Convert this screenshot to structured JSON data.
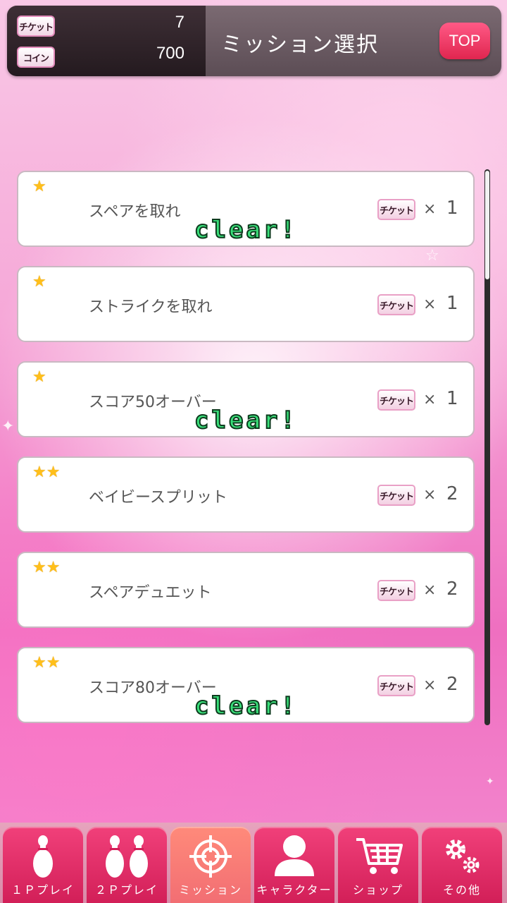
{
  "header": {
    "ticket_label": "チケット",
    "ticket_count": "7",
    "coin_label": "コイン",
    "coin_count": "700",
    "title": "ミッション選択",
    "top_button": "TOP"
  },
  "missions": [
    {
      "stars": "★",
      "name": "スペアを取れ",
      "reward_icon": "チケット",
      "reward_x": "×",
      "reward_qty": "1",
      "status": "clear!"
    },
    {
      "stars": "★",
      "name": "ストライクを取れ",
      "reward_icon": "チケット",
      "reward_x": "×",
      "reward_qty": "1",
      "status": ""
    },
    {
      "stars": "★",
      "name": "スコア50オーバー",
      "reward_icon": "チケット",
      "reward_x": "×",
      "reward_qty": "1",
      "status": "clear!"
    },
    {
      "stars": "★★",
      "name": "ベイビースプリット",
      "reward_icon": "チケット",
      "reward_x": "×",
      "reward_qty": "2",
      "status": ""
    },
    {
      "stars": "★★",
      "name": "スペアデュエット",
      "reward_icon": "チケット",
      "reward_x": "×",
      "reward_qty": "2",
      "status": ""
    },
    {
      "stars": "★★",
      "name": "スコア80オーバー",
      "reward_icon": "チケット",
      "reward_x": "×",
      "reward_qty": "2",
      "status": "clear!"
    }
  ],
  "nav": [
    {
      "label": "１Ｐプレイ",
      "icon": "bowling-pin-icon"
    },
    {
      "label": "２Ｐプレイ",
      "icon": "two-pins-icon"
    },
    {
      "label": "ミッション",
      "icon": "crosshair-icon",
      "active": true
    },
    {
      "label": "キャラクター",
      "icon": "person-icon"
    },
    {
      "label": "ショップ",
      "icon": "cart-icon"
    },
    {
      "label": "その他",
      "icon": "gear-icon"
    }
  ],
  "colors": {
    "accent": "#e0264f",
    "clear_text": "#3adf7a",
    "star": "#ffbf1a"
  }
}
